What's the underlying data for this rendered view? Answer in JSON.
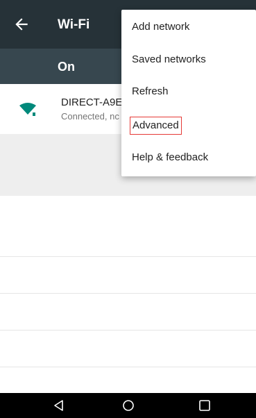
{
  "header": {
    "title": "Wi-Fi",
    "back_icon": "arrow-back-icon"
  },
  "toggle": {
    "label": "On"
  },
  "network": {
    "name": "DIRECT-A9E",
    "status": "Connected, nc",
    "icon": "wifi-signal-icon"
  },
  "menu": {
    "items": [
      {
        "label": "Add network"
      },
      {
        "label": "Saved networks"
      },
      {
        "label": "Refresh"
      },
      {
        "label": "Advanced",
        "highlighted": true
      },
      {
        "label": "Help & feedback"
      }
    ]
  },
  "navbar": {
    "back_icon": "nav-back-icon",
    "home_icon": "nav-home-icon",
    "recents_icon": "nav-recents-icon"
  },
  "colors": {
    "app_bar": "#263238",
    "toggle_bar": "#37474f",
    "wifi_icon": "#00897b",
    "highlight_border": "#e53935"
  }
}
